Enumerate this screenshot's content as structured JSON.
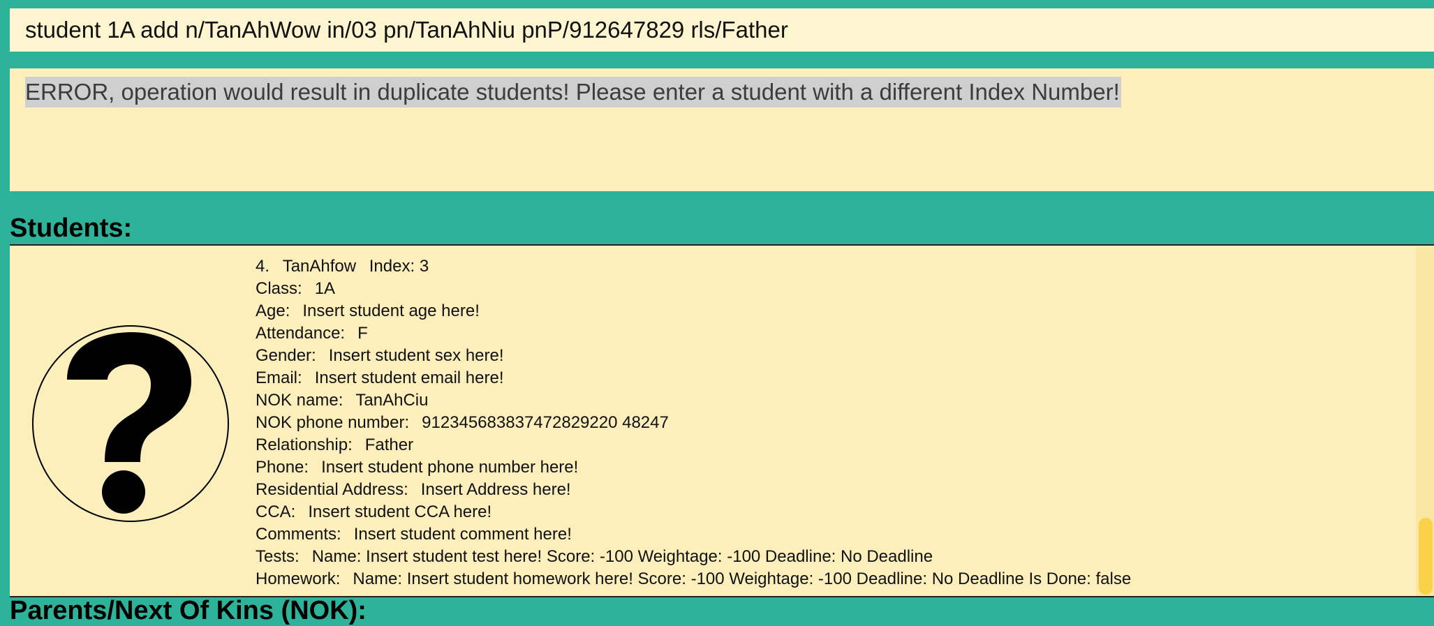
{
  "command_box": {
    "value": "student 1A add n/TanAhWow in/03 pn/TanAhNiu pnP/912647829 rls/Father"
  },
  "result_box": {
    "message": "ERROR, operation would result in duplicate students! Please enter a student with a different Index Number!"
  },
  "students_section": {
    "title": "Students:"
  },
  "nok_section": {
    "title": "Parents/Next Of Kins (NOK):"
  },
  "colors": {
    "background": "#2db39a",
    "panel": "#fcefbc",
    "scrollbar_thumb": "#fad24a"
  },
  "student": {
    "avatar_icon": "question-mark-icon",
    "number": "4.",
    "name": "TanAhfow",
    "index_label": "Index:",
    "index_value": "3",
    "class_label": "Class:",
    "class_value": "1A",
    "age_label": "Age:",
    "age_value": "Insert student age here!",
    "attendance_label": "Attendance:",
    "attendance_value": "F",
    "gender_label": "Gender:",
    "gender_value": "Insert student sex here!",
    "email_label": "Email:",
    "email_value": "Insert student email here!",
    "nok_name_label": "NOK name:",
    "nok_name_value": "TanAhCiu",
    "nok_phone_label": "NOK phone number:",
    "nok_phone_value": "912345683837472829220 48247",
    "relationship_label": "Relationship:",
    "relationship_value": "Father",
    "phone_label": "Phone:",
    "phone_value": "Insert student phone number here!",
    "address_label": "Residential Address:",
    "address_value": "Insert Address here!",
    "cca_label": "CCA:",
    "cca_value": "Insert student CCA here!",
    "comments_label": "Comments:",
    "comments_value": "Insert student comment here!",
    "tests_label": "Tests:",
    "tests_value": "Name: Insert student test here! Score: -100 Weightage: -100 Deadline: No Deadline",
    "homework_label": "Homework:",
    "homework_value": "Name: Insert student homework here! Score: -100 Weightage: -100 Deadline: No Deadline Is Done: false"
  }
}
